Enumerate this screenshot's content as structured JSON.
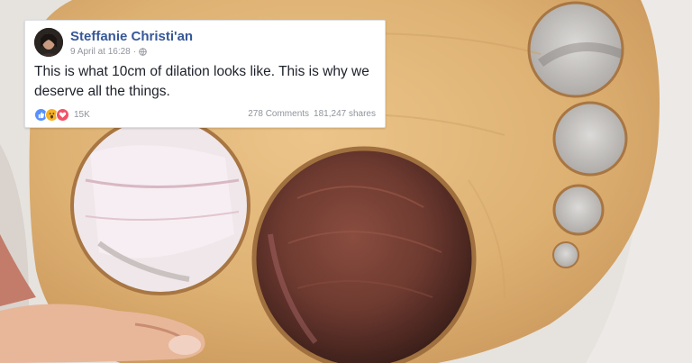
{
  "post": {
    "author": "Steffanie Christi'an",
    "date": "9 April at 16:28",
    "separator": "·",
    "text": "This is what 10cm of dilation looks like. This is why we deserve all the things.",
    "reactions": {
      "types": [
        "like",
        "wow",
        "love"
      ],
      "count": "15K"
    },
    "comments": "278 Comments",
    "shares": "181,247 shares"
  },
  "colors": {
    "author_link": "#365899",
    "like": "#5890ff",
    "wow": "#f7b125",
    "love": "#f25268",
    "wood": "#e0b477"
  }
}
